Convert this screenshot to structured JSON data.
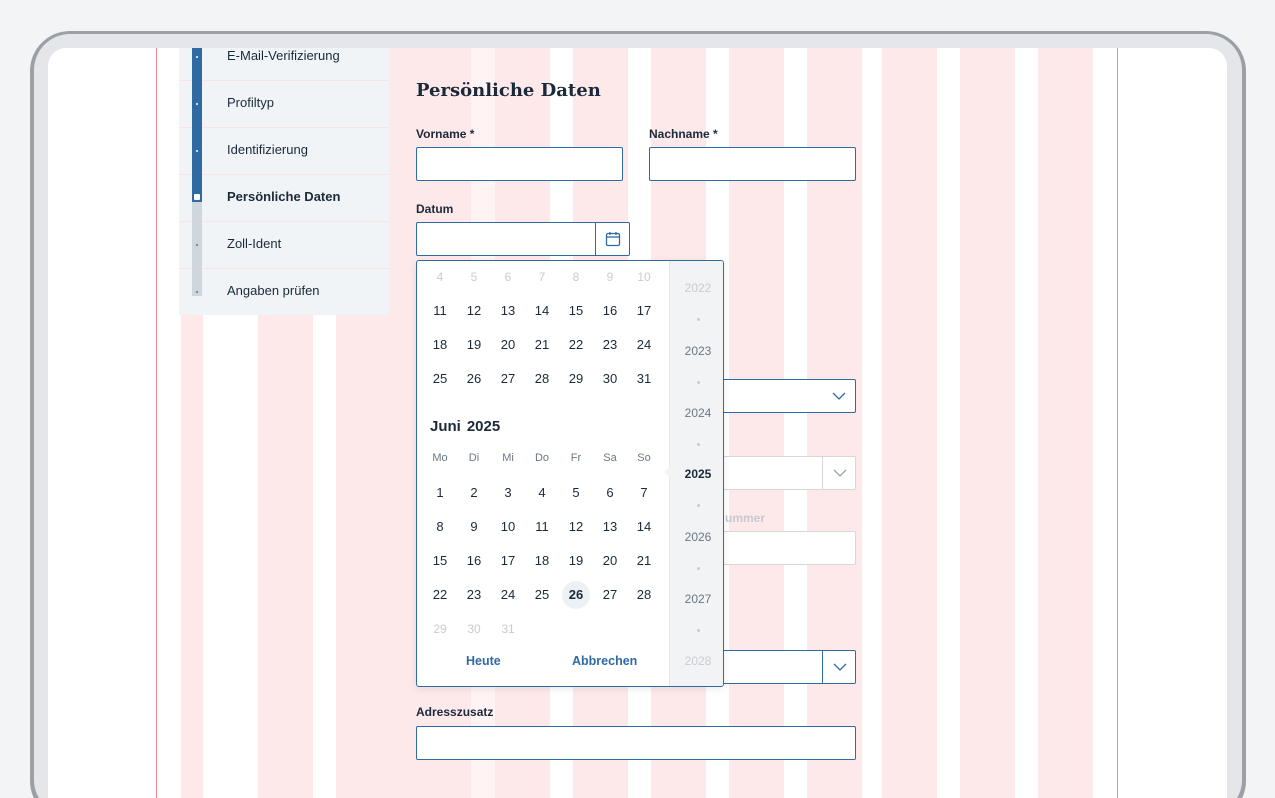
{
  "sidebar": {
    "steps": [
      {
        "label": "E-Mail-Verifizierung",
        "state": "done"
      },
      {
        "label": "Profiltyp",
        "state": "done"
      },
      {
        "label": "Identifizierung",
        "state": "done"
      },
      {
        "label": "Persönliche Daten",
        "state": "current"
      },
      {
        "label": "Zoll-Ident",
        "state": "todo"
      },
      {
        "label": "Angaben prüfen",
        "state": "todo"
      }
    ]
  },
  "form": {
    "title": "Persönliche Daten",
    "vorname_label": "Vorname *",
    "vorname_value": "",
    "nachname_label": "Nachname *",
    "nachname_value": "",
    "datum_label": "Datum",
    "datum_value": "",
    "partial_label": "ummer",
    "adresszusatz_label": "Adresszusatz",
    "adresszusatz_value": ""
  },
  "datepicker": {
    "prev_month_rows": [
      [
        "4",
        "5",
        "6",
        "7",
        "8",
        "9",
        "10"
      ],
      [
        "11",
        "12",
        "13",
        "14",
        "15",
        "16",
        "17"
      ],
      [
        "18",
        "19",
        "20",
        "21",
        "22",
        "23",
        "24"
      ],
      [
        "25",
        "26",
        "27",
        "28",
        "29",
        "30",
        "31"
      ]
    ],
    "month_name": "Juni",
    "month_year": "2025",
    "weekdays": [
      "Mo",
      "Di",
      "Mi",
      "Do",
      "Fr",
      "Sa",
      "So"
    ],
    "rows": [
      [
        "1",
        "2",
        "3",
        "4",
        "5",
        "6",
        "7"
      ],
      [
        "8",
        "9",
        "10",
        "11",
        "12",
        "13",
        "14"
      ],
      [
        "15",
        "16",
        "17",
        "18",
        "19",
        "20",
        "21"
      ],
      [
        "22",
        "23",
        "24",
        "25",
        "26",
        "27",
        "28"
      ],
      [
        "29",
        "30",
        "31",
        "",
        "",
        "",
        ""
      ]
    ],
    "today": "26",
    "today_label": "Heute",
    "cancel_label": "Abbrechen",
    "years": [
      "2022",
      "2023",
      "2024",
      "2025",
      "2026",
      "2027",
      "2028"
    ],
    "selected_year": "2025"
  },
  "colors": {
    "accent": "#2f6aa3",
    "text": "#1b2a3a",
    "grid_overlay": "#fde9ea",
    "grid_border": "#f08a95"
  },
  "icons": {
    "calendar": "calendar-icon",
    "chevron": "chevron-down-icon"
  }
}
